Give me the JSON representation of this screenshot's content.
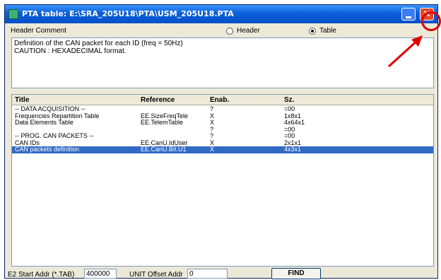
{
  "window": {
    "title": "PTA table: E:\\SRA_205U18\\PTA\\USM_205U18.PTA",
    "close_glyph": "✕"
  },
  "header": {
    "label": "Header Comment",
    "radio_header_label": "Header",
    "radio_table_label": "Table",
    "selected": "Table"
  },
  "comment": {
    "lines": [
      "Definition of the CAN packet for each ID (freq = 50Hz)",
      "CAUTION : HEXADECIMAL format."
    ]
  },
  "grid": {
    "columns": [
      "Title",
      "Reference",
      "Enab.",
      "Sz."
    ],
    "rows": [
      {
        "title": "-- DATA ACQUISITION --",
        "reference": "",
        "enab": "?",
        "size": "=00"
      },
      {
        "title": "Frequencies Repartition Table",
        "reference": "EE.SizeFreqTele",
        "enab": "X",
        "size": "1x8x1"
      },
      {
        "title": "Data Elements Table",
        "reference": "EE.TelemTable",
        "enab": "X",
        "size": "4x64x1"
      },
      {
        "title": "",
        "reference": "",
        "enab": "?",
        "size": "=00"
      },
      {
        "title": "-- PROG. CAN PACKETS --",
        "reference": "",
        "enab": "?",
        "size": "=00"
      },
      {
        "title": "CAN IDs",
        "reference": "EE.CanU.IdUser",
        "enab": "X",
        "size": "2x1x1"
      },
      {
        "title": "CAN packets definition",
        "reference": "EE.CanU.Bit.U1",
        "enab": "X",
        "size": "4x3x1",
        "selected": true
      }
    ]
  },
  "bottom": {
    "e2_label": "E2 Start Addr (*.TAB)",
    "e2_value": "400000",
    "unit_label": "UNIT Offset Addr",
    "unit_value": "0",
    "find_label": "FIND"
  },
  "colors": {
    "titlebar": "#0a5fd8",
    "selection": "#316ac5",
    "highlight": "#e00000"
  }
}
